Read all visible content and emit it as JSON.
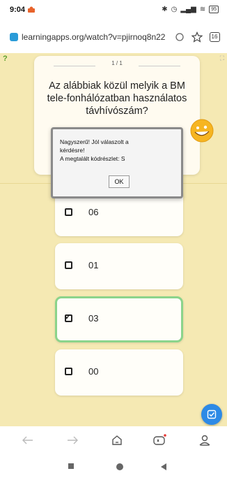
{
  "status": {
    "time": "9:04",
    "battery": "95"
  },
  "browser": {
    "url": "learningapps.org/watch?v=pjirnoq8n22",
    "tab_count": "16"
  },
  "quiz": {
    "counter": "1 / 1",
    "question": "Az alábbiak közül melyik a BM tele-fonhálózatban használatos távhívószám?",
    "answers": [
      {
        "label": "06",
        "checked": false
      },
      {
        "label": "01",
        "checked": false
      },
      {
        "label": "03",
        "checked": true
      },
      {
        "label": "00",
        "checked": false
      }
    ]
  },
  "dialog": {
    "line1": "Nagyszerű! Jól válaszolt a",
    "line2": "kérdésre!",
    "line3": "A megtalált kódrészlet: S",
    "ok_label": "OK"
  },
  "colors": {
    "background": "#f5e9b3",
    "accent": "#2d8ae6",
    "selected_border": "#8bd48b"
  }
}
